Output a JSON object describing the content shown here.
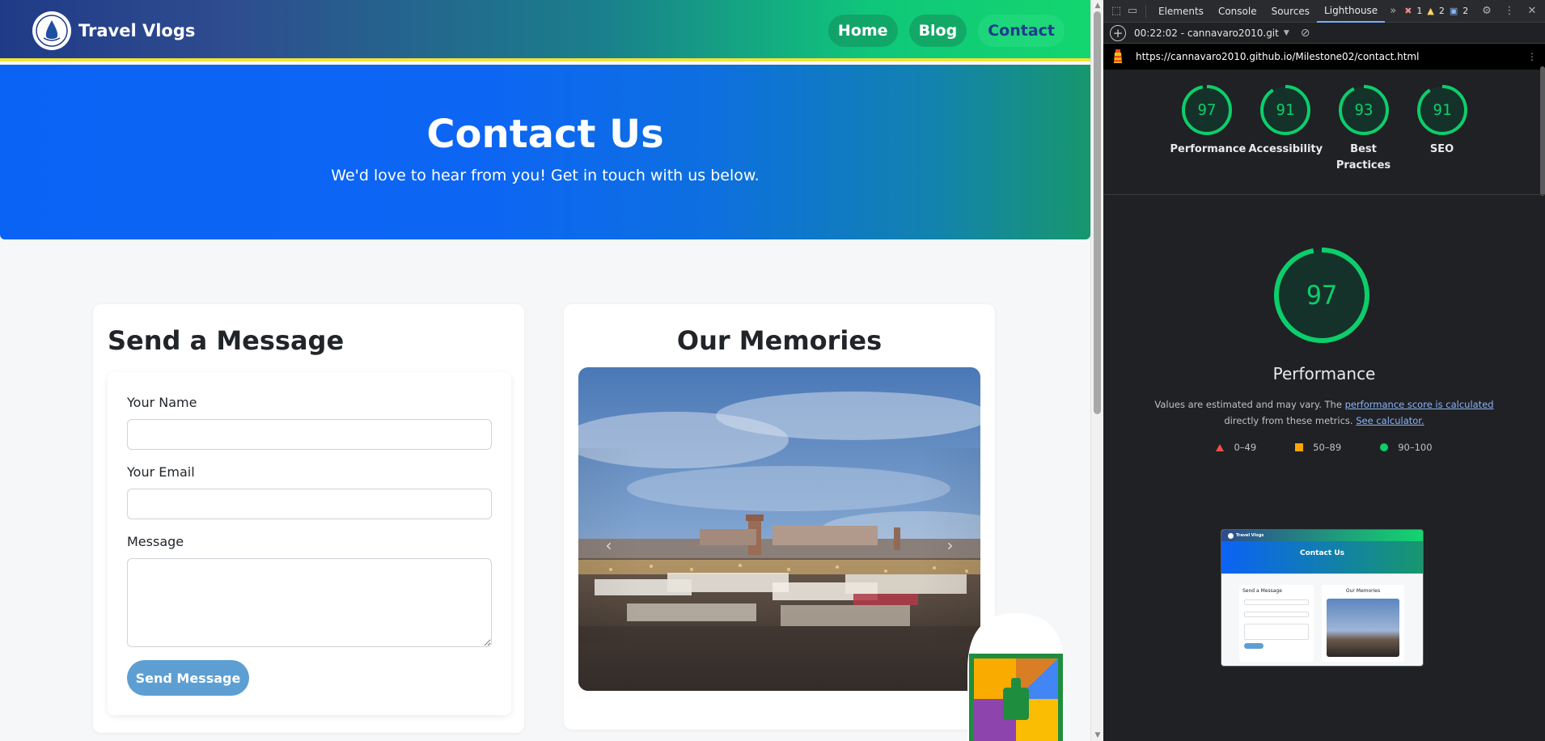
{
  "site": {
    "brand": "Travel Vlogs",
    "nav": [
      {
        "label": "Home",
        "active": false
      },
      {
        "label": "Blog",
        "active": false
      },
      {
        "label": "Contact",
        "active": true
      }
    ],
    "hero": {
      "title": "Contact Us",
      "subtitle": "We'd love to hear from you! Get in touch with us below."
    },
    "message_card": {
      "title": "Send a Message",
      "fields": [
        {
          "label": "Your Name",
          "value": "",
          "placeholder": ""
        },
        {
          "label": "Your Email",
          "value": "",
          "placeholder": ""
        },
        {
          "label": "Message",
          "value": "",
          "placeholder": ""
        }
      ],
      "submit_label": "Send Message"
    },
    "memories_card": {
      "title": "Our Memories",
      "prev_icon": "chevron-left-icon",
      "next_icon": "chevron-right-icon"
    }
  },
  "devtools": {
    "tabs": [
      "Elements",
      "Console",
      "Sources",
      "Lighthouse"
    ],
    "active_tab": "Lighthouse",
    "badges": {
      "errors": "1",
      "warnings": "2",
      "info": "2"
    },
    "report_selector": "00:22:02 - cannavaro2010.git",
    "url": "https://cannavaro2010.github.io/Milestone02/contact.html",
    "scores": [
      {
        "label": "Performance",
        "score": 97
      },
      {
        "label": "Accessibility",
        "score": 91
      },
      {
        "label": "Best Practices",
        "score": 93
      },
      {
        "label": "SEO",
        "score": 91
      }
    ],
    "performance": {
      "score": 97,
      "title": "Performance",
      "desc_prefix": "Values are estimated and may vary. The ",
      "desc_link1": "performance score is calculated",
      "desc_middle": "directly from these metrics. ",
      "desc_link2": "See calculator."
    },
    "legend": [
      {
        "range": "0–49",
        "color": "#ff4e42"
      },
      {
        "range": "50–89",
        "color": "#ffa400"
      },
      {
        "range": "90–100",
        "color": "#0cce6b"
      }
    ],
    "thumbnail": {
      "brand": "Travel Vlogs",
      "title": "Contact Us",
      "left_title": "Send a Message",
      "right_title": "Our Memories"
    }
  },
  "colors": {
    "score_good": "#0cce6b",
    "accent_blue": "#0d6efd",
    "send_button": "#5d9fd3"
  }
}
